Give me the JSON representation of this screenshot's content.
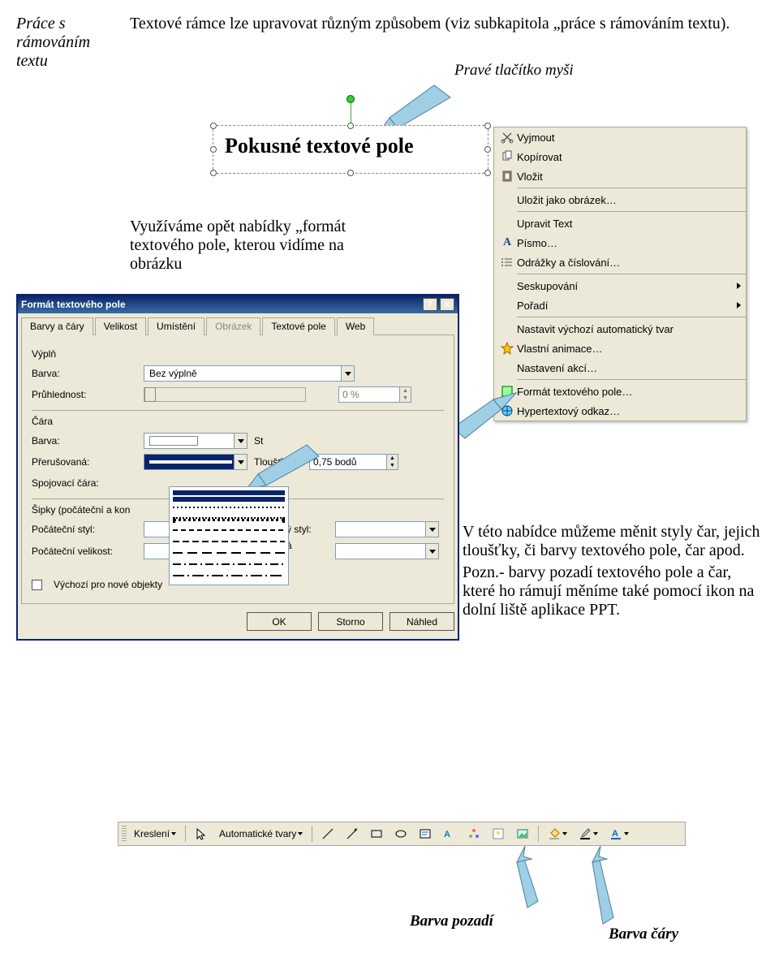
{
  "doc": {
    "margin_title": "Práce s rámováním textu",
    "intro": "Textové rámce lze upravovat  různým způsobem (viz subkapitola „práce s rámováním textu).",
    "right_caption": "Pravé tlačítko myši",
    "text_box_sample": "Pokusné textové pole",
    "use_nabidky": "Využíváme opět nabídky „formát textového pole, kterou vidíme na obrázku",
    "change_styles": "V této nabídce můžeme měnit styly čar, jejich tloušťky, či barvy textového pole, čar apod.",
    "pozn": "Pozn.- barvy pozadí textového pole a čar, které ho rámují  měníme také pomocí ikon na dolní liště aplikace PPT.",
    "fill_label": "Barva pozadí",
    "line_label": "Barva čáry"
  },
  "context_menu": {
    "cut": "Vyjmout",
    "copy": "Kopírovat",
    "paste": "Vložit",
    "save_img": "Uložit jako obrázek…",
    "edit_text": "Upravit Text",
    "font": "Písmo…",
    "bullets": "Odrážky a číslování…",
    "group": "Seskupování",
    "order": "Pořadí",
    "default_shape": "Nastavit výchozí automatický tvar",
    "custom_anim": "Vlastní animace…",
    "action_settings": "Nastavení akcí…",
    "format": "Formát textového pole…",
    "hyperlink": "Hypertextový odkaz…"
  },
  "dialog": {
    "title": "Formát textového pole",
    "tabs": {
      "colors": "Barvy a čáry",
      "size": "Velikost",
      "pos": "Umístění",
      "image": "Obrázek",
      "textbox": "Textové pole",
      "web": "Web"
    },
    "groups": {
      "fill": "Výplň",
      "line": "Čára",
      "arrows": "Šipky (počáteční a kon"
    },
    "labels": {
      "color": "Barva:",
      "transparency": "Průhlednost:",
      "dashed": "Přerušovaná:",
      "style": "St",
      "weight_lbl": "Tloušťka:",
      "conn": "Spojovací čára:",
      "begin_style": "Počáteční styl:",
      "end_style": "Koncový styl:",
      "begin_size": "Počáteční velikost:",
      "end_size": "Koncová velikost:",
      "no_fill": "Bez výplně",
      "pct": "0 %",
      "weight": "0,75 bodů",
      "default_new": "Výchozí pro nové objekty"
    },
    "buttons": {
      "ok": "OK",
      "cancel": "Storno",
      "preview": "Náhled"
    }
  },
  "drawbar": {
    "draw": "Kreslení",
    "autoshapes": "Automatické tvary"
  }
}
